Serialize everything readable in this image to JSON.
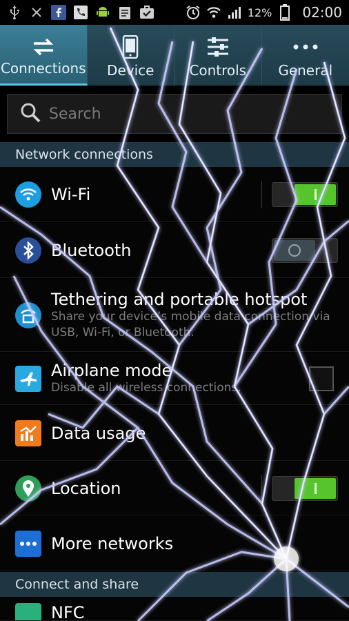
{
  "status_bar": {
    "battery": "12%",
    "time": "02:00"
  },
  "tabs": [
    {
      "label": "Connections",
      "icon": "connections-icon",
      "active": true
    },
    {
      "label": "Device",
      "icon": "phone-icon",
      "active": false
    },
    {
      "label": "Controls",
      "icon": "sliders-icon",
      "active": false
    },
    {
      "label": "General",
      "icon": "more-dots-icon",
      "active": false
    }
  ],
  "search": {
    "placeholder": "Search"
  },
  "sections": {
    "network": "Network connections",
    "connect_share": "Connect and share"
  },
  "rows": {
    "wifi": {
      "title": "Wi-Fi",
      "toggle": "on"
    },
    "bluetooth": {
      "title": "Bluetooth",
      "toggle": "off"
    },
    "tethering": {
      "title": "Tethering and portable hotspot",
      "subtitle": "Share your device’s mobile data connection via USB, Wi-Fi, or Bluetooth."
    },
    "airplane": {
      "title": "Airplane mode",
      "subtitle": "Disable all wireless connections."
    },
    "data_usage": {
      "title": "Data usage"
    },
    "location": {
      "title": "Location",
      "toggle": "on"
    },
    "more_networks": {
      "title": "More networks"
    },
    "nfc": {
      "title": "NFC"
    }
  },
  "colors": {
    "tab_active": "#3b7f97",
    "toggle_on": "#57c32d",
    "section_bg": "#1f3542",
    "lightning": "#c9ccff"
  }
}
